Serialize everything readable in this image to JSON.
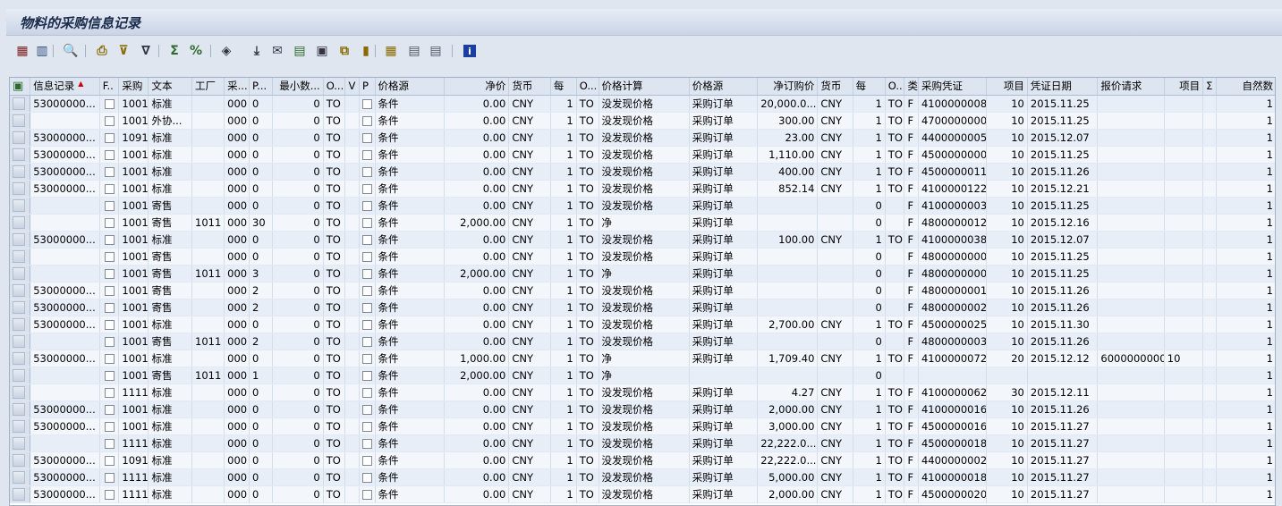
{
  "window": {
    "title": "物料的采购信息记录"
  },
  "toolbar": {
    "buttons": [
      {
        "name": "details-icon",
        "glyph": "▦",
        "color": "#7a1d1d"
      },
      {
        "name": "choose-layout-icon",
        "glyph": "▥",
        "color": "#2b4a7a"
      },
      {
        "name": "find-icon",
        "glyph": "🔍",
        "color": "#1e3c66"
      },
      {
        "name": "print-icon",
        "glyph": "⎙",
        "color": "#8a6a00"
      },
      {
        "name": "filter-icon",
        "glyph": "⊽",
        "color": "#8a6a00"
      },
      {
        "name": "set-filter-icon",
        "glyph": "∇",
        "color": "#334"
      },
      {
        "name": "total-icon",
        "glyph": "Σ",
        "color": "#2d6a2d"
      },
      {
        "name": "subtotal-icon",
        "glyph": "%",
        "color": "#2d6a2d"
      },
      {
        "name": "display-icon",
        "glyph": "◈",
        "color": "#334"
      },
      {
        "name": "export-icon",
        "glyph": "⤓",
        "color": "#334"
      },
      {
        "name": "mail-icon",
        "glyph": "✉",
        "color": "#334"
      },
      {
        "name": "spreadsheet-icon",
        "glyph": "▤",
        "color": "#2d6a2d"
      },
      {
        "name": "word-icon",
        "glyph": "▣",
        "color": "#334"
      },
      {
        "name": "local-file-icon",
        "glyph": "⧉",
        "color": "#8a6a00"
      },
      {
        "name": "graphic-icon",
        "glyph": "▮",
        "color": "#8a6a00"
      },
      {
        "name": "change-layout-icon",
        "glyph": "▦",
        "color": "#8a6a00"
      },
      {
        "name": "select-layout-icon",
        "glyph": "▤",
        "color": "#556"
      },
      {
        "name": "save-layout-icon",
        "glyph": "▤",
        "color": "#556"
      },
      {
        "name": "info-icon",
        "glyph": "i",
        "color": "#ffffff"
      }
    ]
  },
  "table": {
    "columns": [
      "信息记录",
      "F..",
      "采购",
      "文本",
      "工厂",
      "采...",
      "P...",
      "最小数...",
      "O...",
      "V",
      "P",
      "价格源",
      "净价",
      "货币",
      "每",
      "O...",
      "价格计算",
      "价格源",
      "净订购价",
      "货币",
      "每",
      "O...",
      "类",
      "采购凭证",
      "项目",
      "凭证日期",
      "报价请求",
      "项目",
      "Σ",
      "自然数"
    ],
    "rows": [
      [
        "53000000...",
        "",
        "1001",
        "标准",
        "",
        "000",
        "0",
        "0",
        "TO",
        "",
        "",
        "条件",
        "0.00",
        "CNY",
        "1",
        "TO",
        "没发现价格",
        "采购订单",
        "20,000.0...",
        "CNY",
        "1",
        "TO",
        "F",
        "4100000008",
        "10",
        "2015.11.25",
        "",
        "",
        "",
        "1"
      ],
      [
        "",
        "",
        "1001",
        "外协...",
        "",
        "000",
        "0",
        "0",
        "TO",
        "",
        "",
        "条件",
        "0.00",
        "CNY",
        "1",
        "TO",
        "没发现价格",
        "采购订单",
        "300.00",
        "CNY",
        "1",
        "TO",
        "F",
        "4700000000",
        "10",
        "2015.11.25",
        "",
        "",
        "",
        "1"
      ],
      [
        "53000000...",
        "",
        "1091",
        "标准",
        "",
        "000",
        "0",
        "0",
        "TO",
        "",
        "",
        "条件",
        "0.00",
        "CNY",
        "1",
        "TO",
        "没发现价格",
        "采购订单",
        "23.00",
        "CNY",
        "1",
        "TO",
        "F",
        "4400000005",
        "10",
        "2015.12.07",
        "",
        "",
        "",
        "1"
      ],
      [
        "53000000...",
        "",
        "1001",
        "标准",
        "",
        "000",
        "0",
        "0",
        "TO",
        "",
        "",
        "条件",
        "0.00",
        "CNY",
        "1",
        "TO",
        "没发现价格",
        "采购订单",
        "1,110.00",
        "CNY",
        "1",
        "TO",
        "F",
        "4500000000",
        "10",
        "2015.11.25",
        "",
        "",
        "",
        "1"
      ],
      [
        "53000000...",
        "",
        "1001",
        "标准",
        "",
        "000",
        "0",
        "0",
        "TO",
        "",
        "",
        "条件",
        "0.00",
        "CNY",
        "1",
        "TO",
        "没发现价格",
        "采购订单",
        "400.00",
        "CNY",
        "1",
        "TO",
        "F",
        "4500000011",
        "10",
        "2015.11.26",
        "",
        "",
        "",
        "1"
      ],
      [
        "53000000...",
        "",
        "1001",
        "标准",
        "",
        "000",
        "0",
        "0",
        "TO",
        "",
        "",
        "条件",
        "0.00",
        "CNY",
        "1",
        "TO",
        "没发现价格",
        "采购订单",
        "852.14",
        "CNY",
        "1",
        "TO",
        "F",
        "4100000122",
        "10",
        "2015.12.21",
        "",
        "",
        "",
        "1"
      ],
      [
        "",
        "",
        "1001",
        "寄售",
        "",
        "000",
        "0",
        "0",
        "TO",
        "",
        "",
        "条件",
        "0.00",
        "CNY",
        "1",
        "TO",
        "没发现价格",
        "采购订单",
        "",
        "",
        "0",
        "",
        "F",
        "4100000003",
        "10",
        "2015.11.25",
        "",
        "",
        "",
        "1"
      ],
      [
        "",
        "",
        "1001",
        "寄售",
        "1011",
        "000",
        "30",
        "0",
        "TO",
        "",
        "",
        "条件",
        "2,000.00",
        "CNY",
        "1",
        "TO",
        "净",
        "采购订单",
        "",
        "",
        "0",
        "",
        "F",
        "4800000012",
        "10",
        "2015.12.16",
        "",
        "",
        "",
        "1"
      ],
      [
        "53000000...",
        "",
        "1001",
        "标准",
        "",
        "000",
        "0",
        "0",
        "TO",
        "",
        "",
        "条件",
        "0.00",
        "CNY",
        "1",
        "TO",
        "没发现价格",
        "采购订单",
        "100.00",
        "CNY",
        "1",
        "TO",
        "F",
        "4100000038",
        "10",
        "2015.12.07",
        "",
        "",
        "",
        "1"
      ],
      [
        "",
        "",
        "1001",
        "寄售",
        "",
        "000",
        "0",
        "0",
        "TO",
        "",
        "",
        "条件",
        "0.00",
        "CNY",
        "1",
        "TO",
        "没发现价格",
        "采购订单",
        "",
        "",
        "0",
        "",
        "F",
        "4800000000",
        "10",
        "2015.11.25",
        "",
        "",
        "",
        "1"
      ],
      [
        "",
        "",
        "1001",
        "寄售",
        "1011",
        "000",
        "3",
        "0",
        "TO",
        "",
        "",
        "条件",
        "2,000.00",
        "CNY",
        "1",
        "TO",
        "净",
        "采购订单",
        "",
        "",
        "0",
        "",
        "F",
        "4800000000",
        "10",
        "2015.11.25",
        "",
        "",
        "",
        "1"
      ],
      [
        "53000000...",
        "",
        "1001",
        "寄售",
        "",
        "000",
        "2",
        "0",
        "TO",
        "",
        "",
        "条件",
        "0.00",
        "CNY",
        "1",
        "TO",
        "没发现价格",
        "采购订单",
        "",
        "",
        "0",
        "",
        "F",
        "4800000001",
        "10",
        "2015.11.26",
        "",
        "",
        "",
        "1"
      ],
      [
        "53000000...",
        "",
        "1001",
        "寄售",
        "",
        "000",
        "2",
        "0",
        "TO",
        "",
        "",
        "条件",
        "0.00",
        "CNY",
        "1",
        "TO",
        "没发现价格",
        "采购订单",
        "",
        "",
        "0",
        "",
        "F",
        "4800000002",
        "10",
        "2015.11.26",
        "",
        "",
        "",
        "1"
      ],
      [
        "53000000...",
        "",
        "1001",
        "标准",
        "",
        "000",
        "0",
        "0",
        "TO",
        "",
        "",
        "条件",
        "0.00",
        "CNY",
        "1",
        "TO",
        "没发现价格",
        "采购订单",
        "2,700.00",
        "CNY",
        "1",
        "TO",
        "F",
        "4500000025",
        "10",
        "2015.11.30",
        "",
        "",
        "",
        "1"
      ],
      [
        "",
        "",
        "1001",
        "寄售",
        "1011",
        "000",
        "2",
        "0",
        "TO",
        "",
        "",
        "条件",
        "0.00",
        "CNY",
        "1",
        "TO",
        "没发现价格",
        "采购订单",
        "",
        "",
        "0",
        "",
        "F",
        "4800000003",
        "10",
        "2015.11.26",
        "",
        "",
        "",
        "1"
      ],
      [
        "53000000...",
        "",
        "1001",
        "标准",
        "",
        "000",
        "0",
        "0",
        "TO",
        "",
        "",
        "条件",
        "1,000.00",
        "CNY",
        "1",
        "TO",
        "净",
        "采购订单",
        "1,709.40",
        "CNY",
        "1",
        "TO",
        "F",
        "4100000072",
        "20",
        "2015.12.12",
        "6000000000",
        "10",
        "",
        "1"
      ],
      [
        "",
        "",
        "1001",
        "寄售",
        "1011",
        "000",
        "1",
        "0",
        "TO",
        "",
        "",
        "条件",
        "2,000.00",
        "CNY",
        "1",
        "TO",
        "净",
        "",
        "",
        "",
        "0",
        "",
        "",
        "",
        "",
        "",
        "",
        "",
        "",
        "1"
      ],
      [
        "",
        "",
        "1111",
        "标准",
        "",
        "000",
        "0",
        "0",
        "TO",
        "",
        "",
        "条件",
        "0.00",
        "CNY",
        "1",
        "TO",
        "没发现价格",
        "采购订单",
        "4.27",
        "CNY",
        "1",
        "TO",
        "F",
        "4100000062",
        "30",
        "2015.12.11",
        "",
        "",
        "",
        "1"
      ],
      [
        "53000000...",
        "",
        "1001",
        "标准",
        "",
        "000",
        "0",
        "0",
        "TO",
        "",
        "",
        "条件",
        "0.00",
        "CNY",
        "1",
        "TO",
        "没发现价格",
        "采购订单",
        "2,000.00",
        "CNY",
        "1",
        "TO",
        "F",
        "4100000016",
        "10",
        "2015.11.26",
        "",
        "",
        "",
        "1"
      ],
      [
        "53000000...",
        "",
        "1001",
        "标准",
        "",
        "000",
        "0",
        "0",
        "TO",
        "",
        "",
        "条件",
        "0.00",
        "CNY",
        "1",
        "TO",
        "没发现价格",
        "采购订单",
        "3,000.00",
        "CNY",
        "1",
        "TO",
        "F",
        "4500000016",
        "10",
        "2015.11.27",
        "",
        "",
        "",
        "1"
      ],
      [
        "",
        "",
        "1111",
        "标准",
        "",
        "000",
        "0",
        "0",
        "TO",
        "",
        "",
        "条件",
        "0.00",
        "CNY",
        "1",
        "TO",
        "没发现价格",
        "采购订单",
        "22,222.0...",
        "CNY",
        "1",
        "TO",
        "F",
        "4500000018",
        "10",
        "2015.11.27",
        "",
        "",
        "",
        "1"
      ],
      [
        "53000000...",
        "",
        "1091",
        "标准",
        "",
        "000",
        "0",
        "0",
        "TO",
        "",
        "",
        "条件",
        "0.00",
        "CNY",
        "1",
        "TO",
        "没发现价格",
        "采购订单",
        "22,222.0...",
        "CNY",
        "1",
        "TO",
        "F",
        "4400000002",
        "10",
        "2015.11.27",
        "",
        "",
        "",
        "1"
      ],
      [
        "53000000...",
        "",
        "1111",
        "标准",
        "",
        "000",
        "0",
        "0",
        "TO",
        "",
        "",
        "条件",
        "0.00",
        "CNY",
        "1",
        "TO",
        "没发现价格",
        "采购订单",
        "5,000.00",
        "CNY",
        "1",
        "TO",
        "F",
        "4100000018",
        "10",
        "2015.11.27",
        "",
        "",
        "",
        "1"
      ],
      [
        "53000000...",
        "",
        "1111",
        "标准",
        "",
        "000",
        "0",
        "0",
        "TO",
        "",
        "",
        "条件",
        "0.00",
        "CNY",
        "1",
        "TO",
        "没发现价格",
        "采购订单",
        "2,000.00",
        "CNY",
        "1",
        "TO",
        "F",
        "4500000020",
        "10",
        "2015.11.27",
        "",
        "",
        "",
        "1"
      ]
    ]
  }
}
